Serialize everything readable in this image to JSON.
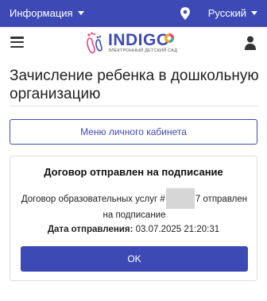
{
  "topbar": {
    "info_label": "Информация",
    "language_label": "Русский"
  },
  "header": {
    "logo_text": "INDIGO",
    "logo_tagline": "ЭЛЕКТРОННЫЙ ДЕТСКИЙ САД"
  },
  "page": {
    "title": "Зачисление ребенка в дошкольную организацию"
  },
  "menu_button": {
    "label": "Меню личного кабинета"
  },
  "dialog": {
    "title": "Договор отправлен на подписание",
    "message_prefix": "Договор образовательных услуг #",
    "message_suffix": "7 отправлен на подписание",
    "date_label": "Дата отправления:",
    "date_value": "03.07.2025 21:20:31",
    "ok_label": "OK"
  },
  "colors": {
    "primary": "#3d4ab5",
    "logo_pink": "#e8477a",
    "logo_orange": "#f5a623",
    "logo_teal": "#2cb5a8"
  }
}
